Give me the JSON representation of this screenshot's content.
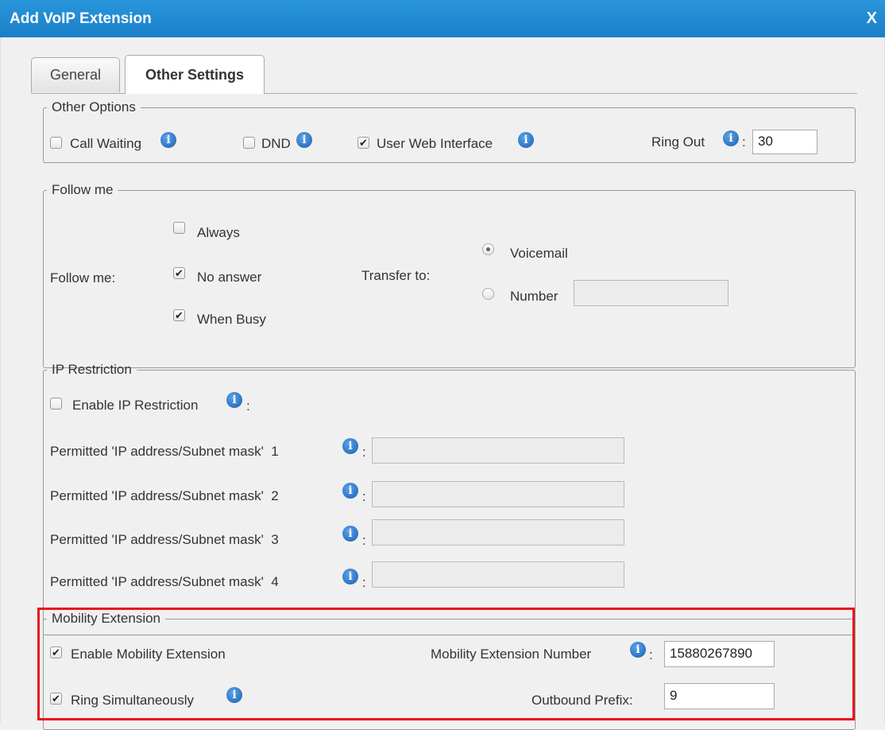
{
  "dialog": {
    "title": "Add VoIP Extension",
    "close_label": "X"
  },
  "tabs": [
    {
      "label": "General",
      "active": false
    },
    {
      "label": "Other Settings",
      "active": true
    }
  ],
  "other_options": {
    "legend": "Other Options",
    "call_waiting": {
      "label": "Call Waiting",
      "checked": false
    },
    "dnd": {
      "label": "DND",
      "checked": false
    },
    "user_web_interface": {
      "label": "User Web Interface",
      "checked": true
    },
    "ring_out": {
      "label": "Ring Out",
      "colon": ":",
      "value": "30"
    }
  },
  "follow_me": {
    "legend": "Follow me",
    "row_label": "Follow me:",
    "always": {
      "label": "Always",
      "checked": false
    },
    "no_answer": {
      "label": "No answer",
      "checked": true
    },
    "when_busy": {
      "label": "When Busy",
      "checked": true
    },
    "transfer_label": "Transfer to:",
    "voicemail": {
      "label": "Voicemail",
      "selected": true
    },
    "number": {
      "label": "Number",
      "selected": false,
      "value": ""
    }
  },
  "ip_restriction": {
    "legend": "IP Restriction",
    "enable": {
      "label": "Enable IP Restriction",
      "colon": ":",
      "checked": false
    },
    "permitted": [
      {
        "label": "Permitted 'IP address/Subnet mask'  1",
        "colon": ":",
        "value": ""
      },
      {
        "label": "Permitted 'IP address/Subnet mask'  2",
        "colon": ":",
        "value": ""
      },
      {
        "label": "Permitted 'IP address/Subnet mask'  3",
        "colon": ":",
        "value": ""
      },
      {
        "label": "Permitted 'IP address/Subnet mask'  4",
        "colon": ":",
        "value": ""
      }
    ]
  },
  "mobility": {
    "legend": "Mobility Extension",
    "enable": {
      "label": "Enable Mobility Extension",
      "checked": true
    },
    "ring_simultaneously": {
      "label": "Ring Simultaneously",
      "checked": true
    },
    "number_label": "Mobility Extension Number",
    "number_colon": ":",
    "number_value": "15880267890",
    "prefix_label": "Outbound Prefix:",
    "prefix_value": "9"
  },
  "icons": {
    "info": "i",
    "check": "✔"
  },
  "colors": {
    "title_bar": "#1a7fc8",
    "highlight": "#e8131b"
  }
}
